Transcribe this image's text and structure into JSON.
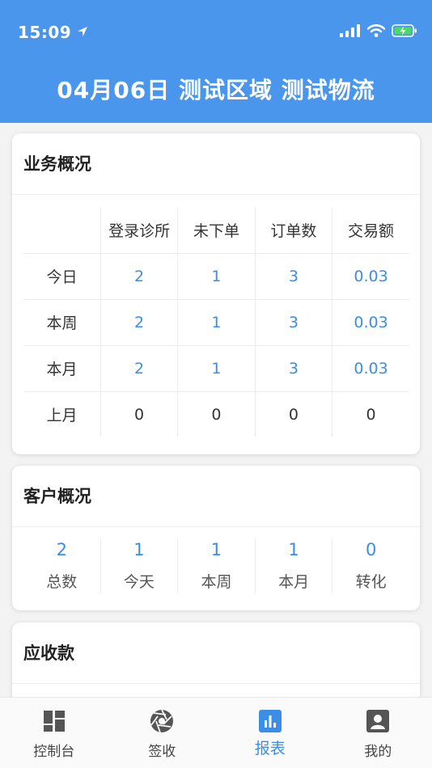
{
  "status": {
    "time": "15:09"
  },
  "header": {
    "title": "04月06日 测试区域 测试物流"
  },
  "business": {
    "title": "业务概况",
    "columns": [
      "登录诊所",
      "未下单",
      "订单数",
      "交易额"
    ],
    "rows": [
      {
        "label": "今日",
        "values": [
          "2",
          "1",
          "3",
          "0.03"
        ]
      },
      {
        "label": "本周",
        "values": [
          "2",
          "1",
          "3",
          "0.03"
        ]
      },
      {
        "label": "本月",
        "values": [
          "2",
          "1",
          "3",
          "0.03"
        ]
      },
      {
        "label": "上月",
        "values": [
          "0",
          "0",
          "0",
          "0"
        ]
      }
    ]
  },
  "customer": {
    "title": "客户概况",
    "items": [
      {
        "value": "2",
        "label": "总数"
      },
      {
        "value": "1",
        "label": "今天"
      },
      {
        "value": "1",
        "label": "本周"
      },
      {
        "value": "1",
        "label": "本月"
      },
      {
        "value": "0",
        "label": "转化"
      }
    ]
  },
  "receivable": {
    "title": "应收款"
  },
  "tabbar": {
    "items": [
      {
        "label": "控制台",
        "icon": "dashboard-icon"
      },
      {
        "label": "签收",
        "icon": "aperture-icon"
      },
      {
        "label": "报表",
        "icon": "bar-chart-icon"
      },
      {
        "label": "我的",
        "icon": "person-icon"
      }
    ]
  },
  "colors": {
    "brand": "#4a96ec",
    "value": "#3a8ee6"
  }
}
